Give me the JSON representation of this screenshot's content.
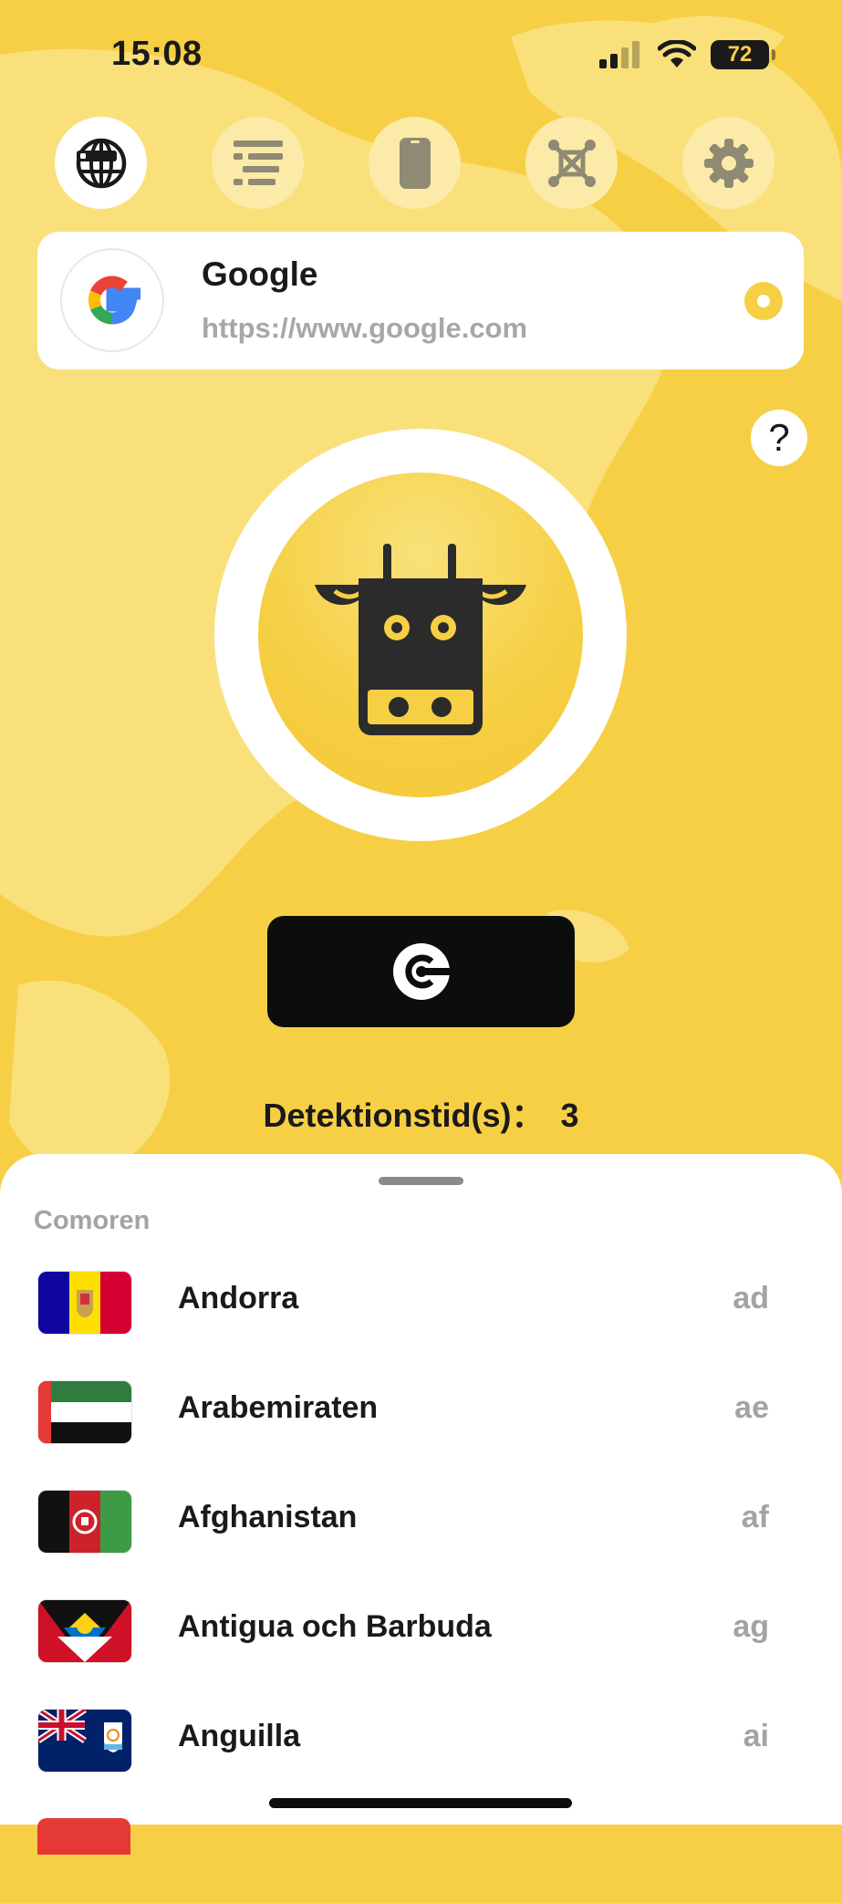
{
  "status_bar": {
    "time": "15:08",
    "battery": "72"
  },
  "top_nav": [
    {
      "icon": "globe-icon",
      "active": true
    },
    {
      "icon": "align-list-icon",
      "active": false
    },
    {
      "icon": "phone-icon",
      "active": false
    },
    {
      "icon": "network-icon",
      "active": false
    },
    {
      "icon": "gear-icon",
      "active": false
    }
  ],
  "site": {
    "name": "Google",
    "url": "https://www.google.com"
  },
  "help": {
    "label": "?"
  },
  "detection": {
    "label": "Detektionstid(s)：",
    "value": "3"
  },
  "sheet": {
    "section_label": "Comoren",
    "countries": [
      {
        "name": "Andorra",
        "code": "ad"
      },
      {
        "name": "Arabemiraten",
        "code": "ae"
      },
      {
        "name": "Afghanistan",
        "code": "af"
      },
      {
        "name": "Antigua och Barbuda",
        "code": "ag"
      },
      {
        "name": "Anguilla",
        "code": "ai"
      }
    ]
  },
  "colors": {
    "accent": "#f7cf45",
    "dark": "#1a1a1a",
    "muted": "#a3a3a3"
  }
}
